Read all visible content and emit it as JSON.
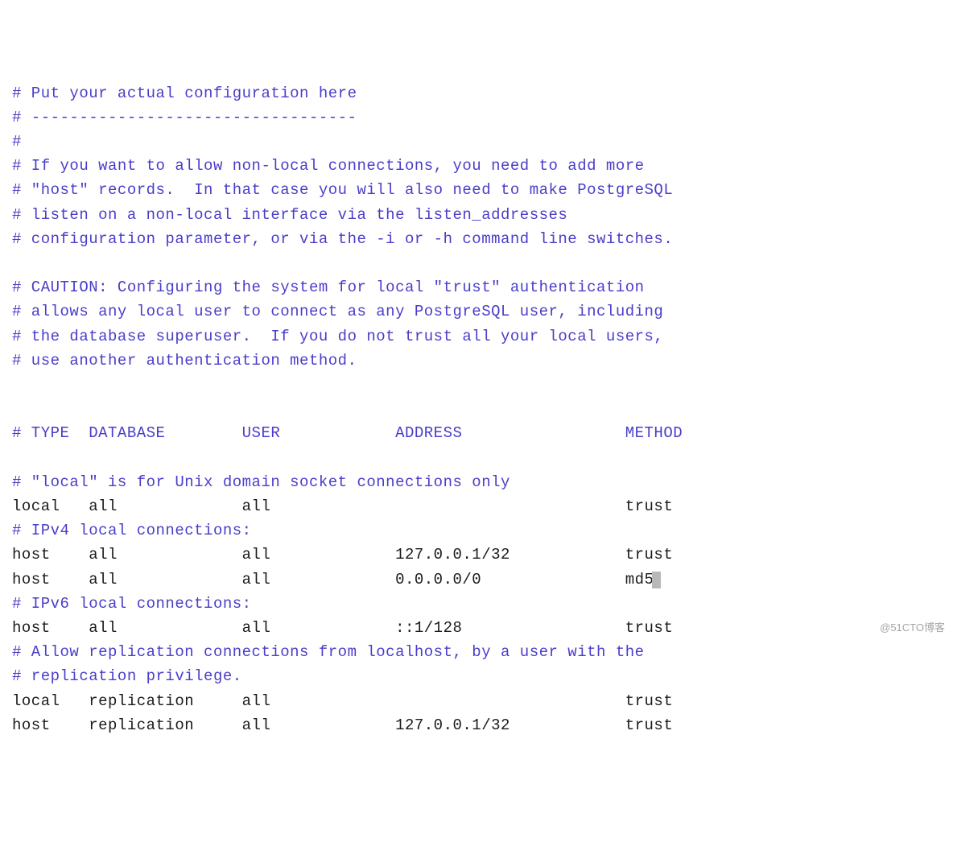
{
  "lines": [
    {
      "class": "comment",
      "text": "# Put your actual configuration here"
    },
    {
      "class": "comment",
      "text": "# ----------------------------------"
    },
    {
      "class": "comment",
      "text": "#"
    },
    {
      "class": "comment",
      "text": "# If you want to allow non-local connections, you need to add more"
    },
    {
      "class": "comment",
      "text": "# \"host\" records.  In that case you will also need to make PostgreSQL"
    },
    {
      "class": "comment",
      "text": "# listen on a non-local interface via the listen_addresses"
    },
    {
      "class": "comment",
      "text": "# configuration parameter, or via the -i or -h command line switches."
    },
    {
      "class": "comment",
      "text": " "
    },
    {
      "class": "comment",
      "text": "# CAUTION: Configuring the system for local \"trust\" authentication"
    },
    {
      "class": "comment",
      "text": "# allows any local user to connect as any PostgreSQL user, including"
    },
    {
      "class": "comment",
      "text": "# the database superuser.  If you do not trust all your local users,"
    },
    {
      "class": "comment",
      "text": "# use another authentication method."
    },
    {
      "class": "comment",
      "text": " "
    },
    {
      "class": "comment",
      "text": " "
    },
    {
      "class": "comment",
      "text": "# TYPE  DATABASE        USER            ADDRESS                 METHOD"
    },
    {
      "class": "comment",
      "text": " "
    },
    {
      "class": "comment",
      "text": "# \"local\" is for Unix domain socket connections only"
    },
    {
      "class": "text",
      "text": "local   all             all                                     trust"
    },
    {
      "class": "comment",
      "text": "# IPv4 local connections:"
    },
    {
      "class": "text",
      "text": "host    all             all             127.0.0.1/32            trust"
    },
    {
      "class": "text",
      "text": "host    all             all             0.0.0.0/0               md5",
      "cursor": true
    },
    {
      "class": "comment",
      "text": "# IPv6 local connections:"
    },
    {
      "class": "text",
      "text": "host    all             all             ::1/128                 trust"
    },
    {
      "class": "comment",
      "text": "# Allow replication connections from localhost, by a user with the"
    },
    {
      "class": "comment",
      "text": "# replication privilege."
    },
    {
      "class": "text",
      "text": "local   replication     all                                     trust"
    },
    {
      "class": "text",
      "text": "host    replication     all             127.0.0.1/32            trust"
    }
  ],
  "watermark": "@51CTO博客"
}
